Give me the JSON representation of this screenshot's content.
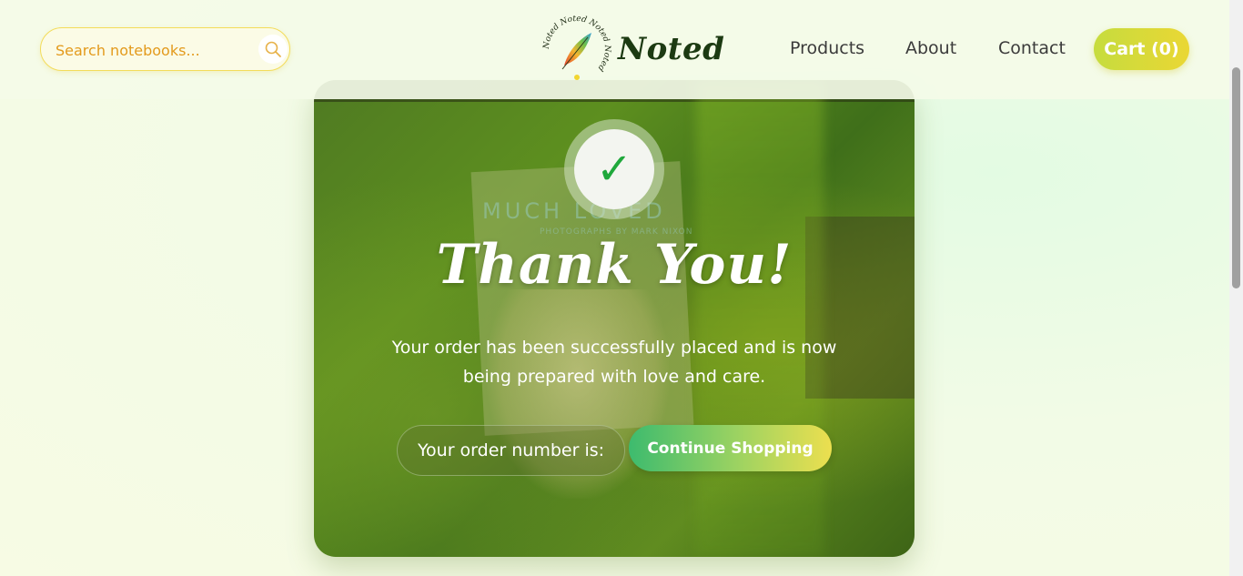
{
  "header": {
    "search": {
      "placeholder": "Search notebooks..."
    },
    "logo": {
      "text": "Noted",
      "ring_text": "Noted Noted Noted Noted"
    },
    "nav": [
      {
        "label": "Products"
      },
      {
        "label": "About"
      },
      {
        "label": "Contact"
      }
    ],
    "cart": {
      "label": "Cart",
      "count": "(0)"
    }
  },
  "card": {
    "background_text": {
      "title": "MUCH LOVED",
      "subtitle": "PHOTOGRAPHS BY MARK NIXON"
    },
    "check_symbol": "✓",
    "title": "Thank You!",
    "message": "Your order has been successfully placed and is now being prepared with love and care.",
    "order_label": "Your order number is:",
    "continue_label": "Continue Shopping"
  },
  "colors": {
    "accent_yellow": "#ead734",
    "accent_green": "#3dbb6e",
    "check_green": "#1fa83b",
    "search_text": "#e39a1c"
  },
  "icons": [
    "search-icon",
    "feather-icon",
    "checkmark-icon"
  ]
}
